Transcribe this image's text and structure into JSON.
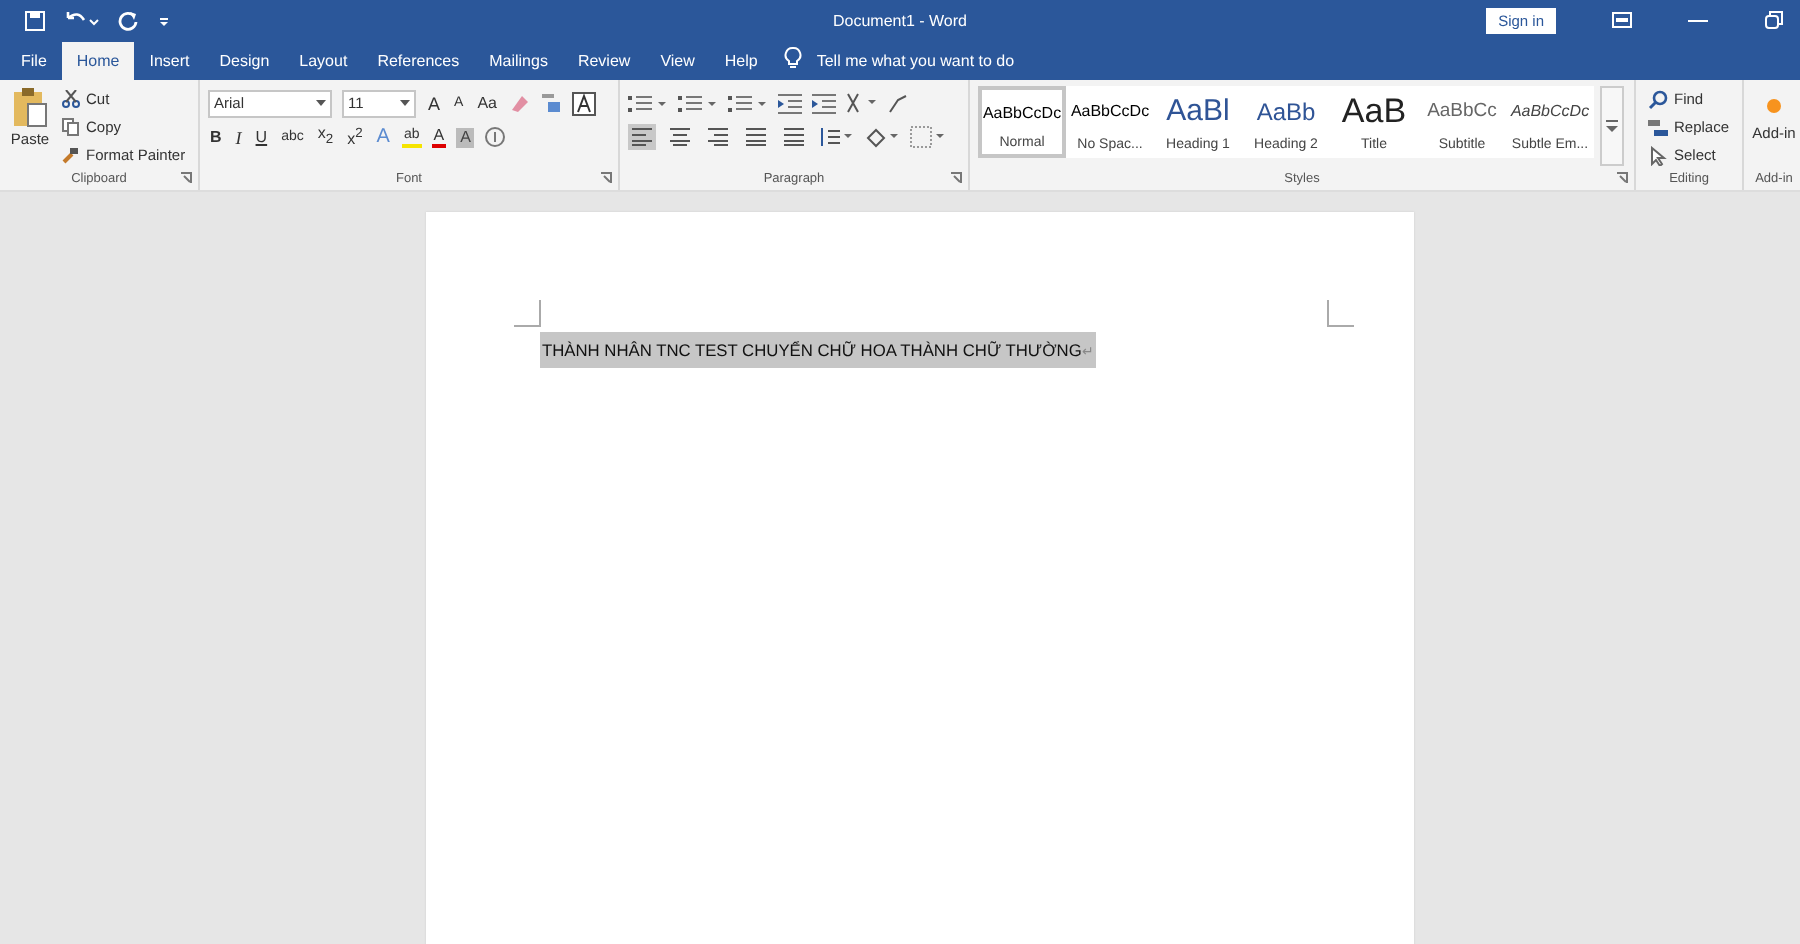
{
  "window": {
    "title": "Document1 - Word",
    "sign_in": "Sign in"
  },
  "tabs": [
    {
      "label": "File",
      "selected": false
    },
    {
      "label": "Home",
      "selected": true
    },
    {
      "label": "Insert",
      "selected": false
    },
    {
      "label": "Design",
      "selected": false
    },
    {
      "label": "Layout",
      "selected": false
    },
    {
      "label": "References",
      "selected": false
    },
    {
      "label": "Mailings",
      "selected": false
    },
    {
      "label": "Review",
      "selected": false
    },
    {
      "label": "View",
      "selected": false
    },
    {
      "label": "Help",
      "selected": false
    }
  ],
  "tell_me": "Tell me what you want to do",
  "clipboard": {
    "paste": "Paste",
    "items": [
      "Cut",
      "Copy",
      "Format Painter"
    ],
    "label": "Clipboard"
  },
  "font": {
    "name": "Arial",
    "size": "11",
    "row1": [
      {
        "text": "A",
        "kind": "grow"
      },
      {
        "text": "A",
        "kind": "shrink"
      },
      {
        "text": "Aa",
        "kind": "case"
      }
    ],
    "row2": [
      {
        "text": "B",
        "kind": "bold"
      },
      {
        "text": "I",
        "kind": "italic"
      },
      {
        "text": "U",
        "kind": "underline"
      },
      {
        "text": "abc",
        "kind": "strike"
      },
      {
        "text": "x$_{2}$",
        "kind": "plain"
      },
      {
        "text": "x$^{2}$",
        "kind": "plain"
      },
      {
        "text": "A",
        "kind": "effects"
      },
      {
        "text": "ab",
        "kind": "highlight"
      },
      {
        "text": "A",
        "kind": "color"
      },
      {
        "text": "A",
        "kind": "shade"
      }
    ],
    "label": "Font"
  },
  "paragraph": {
    "alignments": [
      {
        "selected": true
      },
      {
        "selected": false
      },
      {
        "selected": false
      },
      {
        "selected": false
      },
      {
        "selected": false
      }
    ],
    "label": "Paragraph"
  },
  "styles": {
    "items": [
      {
        "preview": "AaBbCcDc",
        "name": "Normal",
        "kind": "body",
        "selected": true
      },
      {
        "preview": "AaBbCcDc",
        "name": "No Spac...",
        "kind": "body",
        "selected": false
      },
      {
        "preview": "AaBl",
        "name": "Heading 1",
        "kind": "heading1",
        "selected": false
      },
      {
        "preview": "AaBb",
        "name": "Heading 2",
        "kind": "heading2",
        "selected": false
      },
      {
        "preview": "AaB",
        "name": "Title",
        "kind": "title",
        "selected": false
      },
      {
        "preview": "AaBbCc",
        "name": "Subtitle",
        "kind": "subtitle",
        "selected": false
      },
      {
        "preview": "AaBbCcDc",
        "name": "Subtle Em...",
        "kind": "emphasis",
        "selected": false
      }
    ],
    "label": "Styles"
  },
  "editing": {
    "items": [
      "Find",
      "Replace",
      "Select"
    ],
    "label": "Editing"
  },
  "addins": {
    "button": "Add-in",
    "label": "Add-in"
  },
  "document": {
    "text": "THÀNH NHÂN TNC TEST CHUYỂN CHỮ HOA THÀNH CHỮ THƯỜNG",
    "mark": "↵",
    "selected": true
  }
}
